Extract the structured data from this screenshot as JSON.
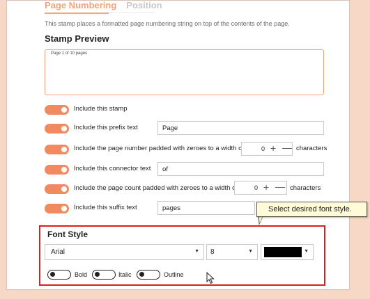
{
  "tabs": [
    {
      "label": "Page Numbering",
      "active": true
    },
    {
      "label": "Position",
      "active": false
    }
  ],
  "description": "This stamp places a formatted page numbering string on top of the contents of the page.",
  "preview": {
    "title": "Stamp Preview",
    "text": "Page 1 of 10 pages"
  },
  "options": {
    "include_stamp": "Include this stamp",
    "prefix_label": "Include this prefix text",
    "prefix_value": "Page",
    "page_number_label": "Include the page number padded with zeroes to a width of",
    "page_number_width": "0",
    "page_number_unit": "characters",
    "connector_label": "Include this connector text",
    "connector_value": "of",
    "page_count_label": "Include the page count padded with zeroes to a width of",
    "page_count_width": "0",
    "page_count_unit": "characters",
    "suffix_label": "Include this suffix text",
    "suffix_value": "pages"
  },
  "tooltip": "Select desired font style.",
  "font_style": {
    "title": "Font Style",
    "font_value": "Arial",
    "size_value": "8",
    "color_value": "#000000",
    "bold_label": "Bold",
    "italic_label": "Italic",
    "outline_label": "Outline"
  },
  "colors": {
    "accent": "#f2895f",
    "highlight": "#d91f1f",
    "background": "#f7d7c5"
  }
}
